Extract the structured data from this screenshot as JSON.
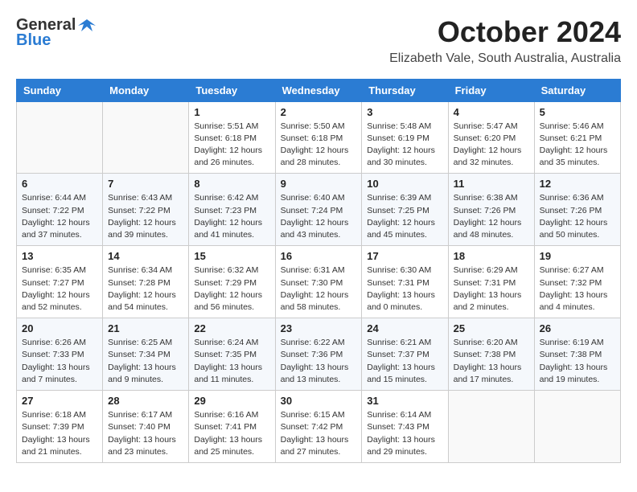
{
  "header": {
    "logo_general": "General",
    "logo_blue": "Blue",
    "month_year": "October 2024",
    "location": "Elizabeth Vale, South Australia, Australia"
  },
  "days_of_week": [
    "Sunday",
    "Monday",
    "Tuesday",
    "Wednesday",
    "Thursday",
    "Friday",
    "Saturday"
  ],
  "weeks": [
    [
      {
        "day": "",
        "info": ""
      },
      {
        "day": "",
        "info": ""
      },
      {
        "day": "1",
        "info": "Sunrise: 5:51 AM\nSunset: 6:18 PM\nDaylight: 12 hours and 26 minutes."
      },
      {
        "day": "2",
        "info": "Sunrise: 5:50 AM\nSunset: 6:18 PM\nDaylight: 12 hours and 28 minutes."
      },
      {
        "day": "3",
        "info": "Sunrise: 5:48 AM\nSunset: 6:19 PM\nDaylight: 12 hours and 30 minutes."
      },
      {
        "day": "4",
        "info": "Sunrise: 5:47 AM\nSunset: 6:20 PM\nDaylight: 12 hours and 32 minutes."
      },
      {
        "day": "5",
        "info": "Sunrise: 5:46 AM\nSunset: 6:21 PM\nDaylight: 12 hours and 35 minutes."
      }
    ],
    [
      {
        "day": "6",
        "info": "Sunrise: 6:44 AM\nSunset: 7:22 PM\nDaylight: 12 hours and 37 minutes."
      },
      {
        "day": "7",
        "info": "Sunrise: 6:43 AM\nSunset: 7:22 PM\nDaylight: 12 hours and 39 minutes."
      },
      {
        "day": "8",
        "info": "Sunrise: 6:42 AM\nSunset: 7:23 PM\nDaylight: 12 hours and 41 minutes."
      },
      {
        "day": "9",
        "info": "Sunrise: 6:40 AM\nSunset: 7:24 PM\nDaylight: 12 hours and 43 minutes."
      },
      {
        "day": "10",
        "info": "Sunrise: 6:39 AM\nSunset: 7:25 PM\nDaylight: 12 hours and 45 minutes."
      },
      {
        "day": "11",
        "info": "Sunrise: 6:38 AM\nSunset: 7:26 PM\nDaylight: 12 hours and 48 minutes."
      },
      {
        "day": "12",
        "info": "Sunrise: 6:36 AM\nSunset: 7:26 PM\nDaylight: 12 hours and 50 minutes."
      }
    ],
    [
      {
        "day": "13",
        "info": "Sunrise: 6:35 AM\nSunset: 7:27 PM\nDaylight: 12 hours and 52 minutes."
      },
      {
        "day": "14",
        "info": "Sunrise: 6:34 AM\nSunset: 7:28 PM\nDaylight: 12 hours and 54 minutes."
      },
      {
        "day": "15",
        "info": "Sunrise: 6:32 AM\nSunset: 7:29 PM\nDaylight: 12 hours and 56 minutes."
      },
      {
        "day": "16",
        "info": "Sunrise: 6:31 AM\nSunset: 7:30 PM\nDaylight: 12 hours and 58 minutes."
      },
      {
        "day": "17",
        "info": "Sunrise: 6:30 AM\nSunset: 7:31 PM\nDaylight: 13 hours and 0 minutes."
      },
      {
        "day": "18",
        "info": "Sunrise: 6:29 AM\nSunset: 7:31 PM\nDaylight: 13 hours and 2 minutes."
      },
      {
        "day": "19",
        "info": "Sunrise: 6:27 AM\nSunset: 7:32 PM\nDaylight: 13 hours and 4 minutes."
      }
    ],
    [
      {
        "day": "20",
        "info": "Sunrise: 6:26 AM\nSunset: 7:33 PM\nDaylight: 13 hours and 7 minutes."
      },
      {
        "day": "21",
        "info": "Sunrise: 6:25 AM\nSunset: 7:34 PM\nDaylight: 13 hours and 9 minutes."
      },
      {
        "day": "22",
        "info": "Sunrise: 6:24 AM\nSunset: 7:35 PM\nDaylight: 13 hours and 11 minutes."
      },
      {
        "day": "23",
        "info": "Sunrise: 6:22 AM\nSunset: 7:36 PM\nDaylight: 13 hours and 13 minutes."
      },
      {
        "day": "24",
        "info": "Sunrise: 6:21 AM\nSunset: 7:37 PM\nDaylight: 13 hours and 15 minutes."
      },
      {
        "day": "25",
        "info": "Sunrise: 6:20 AM\nSunset: 7:38 PM\nDaylight: 13 hours and 17 minutes."
      },
      {
        "day": "26",
        "info": "Sunrise: 6:19 AM\nSunset: 7:38 PM\nDaylight: 13 hours and 19 minutes."
      }
    ],
    [
      {
        "day": "27",
        "info": "Sunrise: 6:18 AM\nSunset: 7:39 PM\nDaylight: 13 hours and 21 minutes."
      },
      {
        "day": "28",
        "info": "Sunrise: 6:17 AM\nSunset: 7:40 PM\nDaylight: 13 hours and 23 minutes."
      },
      {
        "day": "29",
        "info": "Sunrise: 6:16 AM\nSunset: 7:41 PM\nDaylight: 13 hours and 25 minutes."
      },
      {
        "day": "30",
        "info": "Sunrise: 6:15 AM\nSunset: 7:42 PM\nDaylight: 13 hours and 27 minutes."
      },
      {
        "day": "31",
        "info": "Sunrise: 6:14 AM\nSunset: 7:43 PM\nDaylight: 13 hours and 29 minutes."
      },
      {
        "day": "",
        "info": ""
      },
      {
        "day": "",
        "info": ""
      }
    ]
  ]
}
